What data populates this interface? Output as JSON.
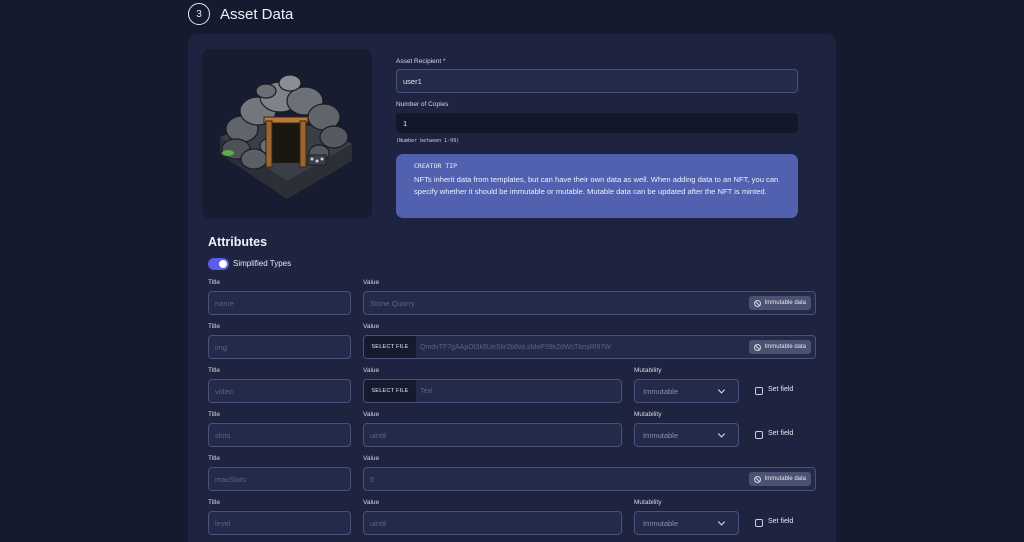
{
  "step": {
    "number": "3",
    "title": "Asset Data"
  },
  "asset_image": {
    "description_icon": "stone-quarry-illustration"
  },
  "recipient": {
    "label": "Asset Recipient *",
    "value": "user1"
  },
  "copies": {
    "label": "Number of Copies",
    "value": "1",
    "hint": "(Number between 1-99)"
  },
  "tip": {
    "title": "CREATOR TIP",
    "body": "NFTs inherit data from templates, but can have their own data as well. When adding data to an NFT, you can specify whether it should be immutable or mutable. Mutable data can be updated after the NFT is minted."
  },
  "attributes": {
    "heading": "Attributes",
    "simplified_label": "Simplified Types",
    "simplified_enabled": true,
    "title_label": "Title",
    "value_label": "Value",
    "mutability_label": "Mutability",
    "select_file_label": "SELECT FILE",
    "immutable_badge": "Immutable data",
    "set_field_label": "Set field",
    "rows": [
      {
        "title": "name",
        "value": "Stone Quarry",
        "kind": "immutable"
      },
      {
        "title": "img",
        "value": "QmdvTF7gAApOt3k6UeSkr2b8wLsMeP39k2dWsTbmjRf97W",
        "kind": "file-immutable"
      },
      {
        "title": "video",
        "value": "Text",
        "kind": "file-mutable",
        "mutability": "Immutable"
      },
      {
        "title": "slots",
        "value": "uint8",
        "kind": "mutable",
        "mutability": "Immutable"
      },
      {
        "title": "maxSlots",
        "value": "5",
        "kind": "immutable"
      },
      {
        "title": "level",
        "value": "uint8",
        "kind": "mutable",
        "mutability": "Immutable"
      }
    ]
  }
}
